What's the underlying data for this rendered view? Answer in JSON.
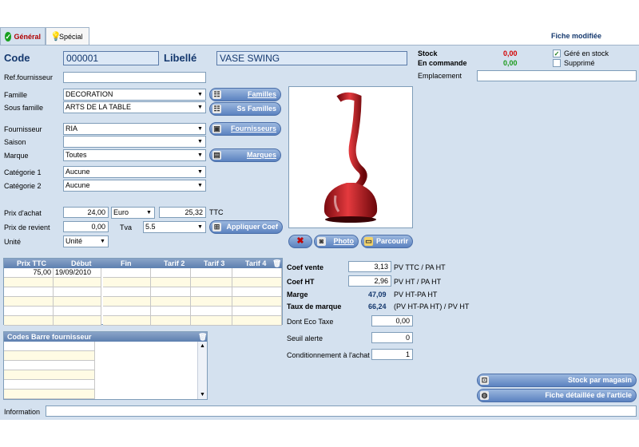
{
  "tabs": [
    {
      "label": "Général"
    },
    {
      "label": "Spécial"
    }
  ],
  "status": "Fiche modifiée",
  "header": {
    "code_label": "Code",
    "code_value": "000001",
    "libelle_label": "Libellé",
    "libelle_value": "VASE SWING"
  },
  "stock": {
    "stock_label": "Stock",
    "stock_value": "0,00",
    "commande_label": "En commande",
    "commande_value": "0,00",
    "gere_label": "Géré en stock",
    "gere_checked": true,
    "supprime_label": "Supprimé",
    "supprime_checked": false,
    "emplacement_label": "Emplacement",
    "emplacement_value": ""
  },
  "form": {
    "ref_label": "Ref.fournisseur",
    "ref_value": "",
    "famille_label": "Famille",
    "famille_value": "DECORATION",
    "sousfamille_label": "Sous famille",
    "sousfamille_value": "ARTS DE LA TABLE",
    "fournisseur_label": "Fournisseur",
    "fournisseur_value": "RIA",
    "saison_label": "Saison",
    "saison_value": "",
    "marque_label": "Marque",
    "marque_value": "Toutes",
    "categorie1_label": "Catégorie 1",
    "categorie1_value": "Aucune",
    "categorie2_label": "Catégorie 2",
    "categorie2_value": "Aucune",
    "prix_achat_label": "Prix d'achat",
    "prix_achat_value": "24,00",
    "devise_value": "Euro",
    "ttc_value": "25,32",
    "ttc_label": "TTC",
    "prix_revient_label": "Prix de revient",
    "prix_revient_value": "0,00",
    "tva_label": "Tva",
    "tva_value": "5.5",
    "unite_label": "Unité",
    "unite_value": "Unité"
  },
  "buttons": {
    "familles": "Familles",
    "ssfamilles": "Ss Familles",
    "fournisseurs": "Fournisseurs",
    "marques": "Marques",
    "appliquer": "Appliquer Coef",
    "photo": "Photo",
    "parcourir": "Parcourir",
    "stock_magasin": "Stock par magasin",
    "fiche_detail": "Fiche détaillée de l'article"
  },
  "tarif_table": {
    "columns": [
      "Prix TTC",
      "Début",
      "Fin",
      "Tarif 2",
      "Tarif 3",
      "Tarif 4"
    ],
    "rows": [
      [
        "75,00",
        "19/09/2010",
        "",
        "",
        "",
        ""
      ],
      [
        "",
        "",
        "",
        "",
        "",
        ""
      ],
      [
        "",
        "",
        "",
        "",
        "",
        ""
      ],
      [
        "",
        "",
        "",
        "",
        "",
        ""
      ],
      [
        "",
        "",
        "",
        "",
        "",
        ""
      ],
      [
        "",
        "",
        "",
        "",
        "",
        ""
      ]
    ]
  },
  "codes_barre": {
    "title": "Codes Barre fournisseur",
    "rows": [
      "",
      "",
      "",
      "",
      "",
      ""
    ]
  },
  "coef": {
    "coef_vente_label": "Coef vente",
    "coef_vente_value": "3,13",
    "coef_vente_desc": "PV TTC / PA HT",
    "coef_ht_label": "Coef HT",
    "coef_ht_value": "2,96",
    "coef_ht_desc": "PV HT / PA HT",
    "marge_label": "Marge",
    "marge_value": "47,09",
    "marge_desc": "PV HT-PA HT",
    "taux_label": "Taux de marque",
    "taux_value": "66,24",
    "taux_desc": "(PV HT-PA HT) / PV HT",
    "eco_label": "Dont Eco Taxe",
    "eco_value": "0,00",
    "seuil_label": "Seuil alerte",
    "seuil_value": "0",
    "cond_label": "Conditionnement à l'achat",
    "cond_value": "1"
  },
  "information": {
    "label": "Information",
    "value": ""
  },
  "colors": {
    "accent": "#14386e",
    "red": "#d40000",
    "green": "#1a9a1a",
    "vase": "#c8141c"
  }
}
